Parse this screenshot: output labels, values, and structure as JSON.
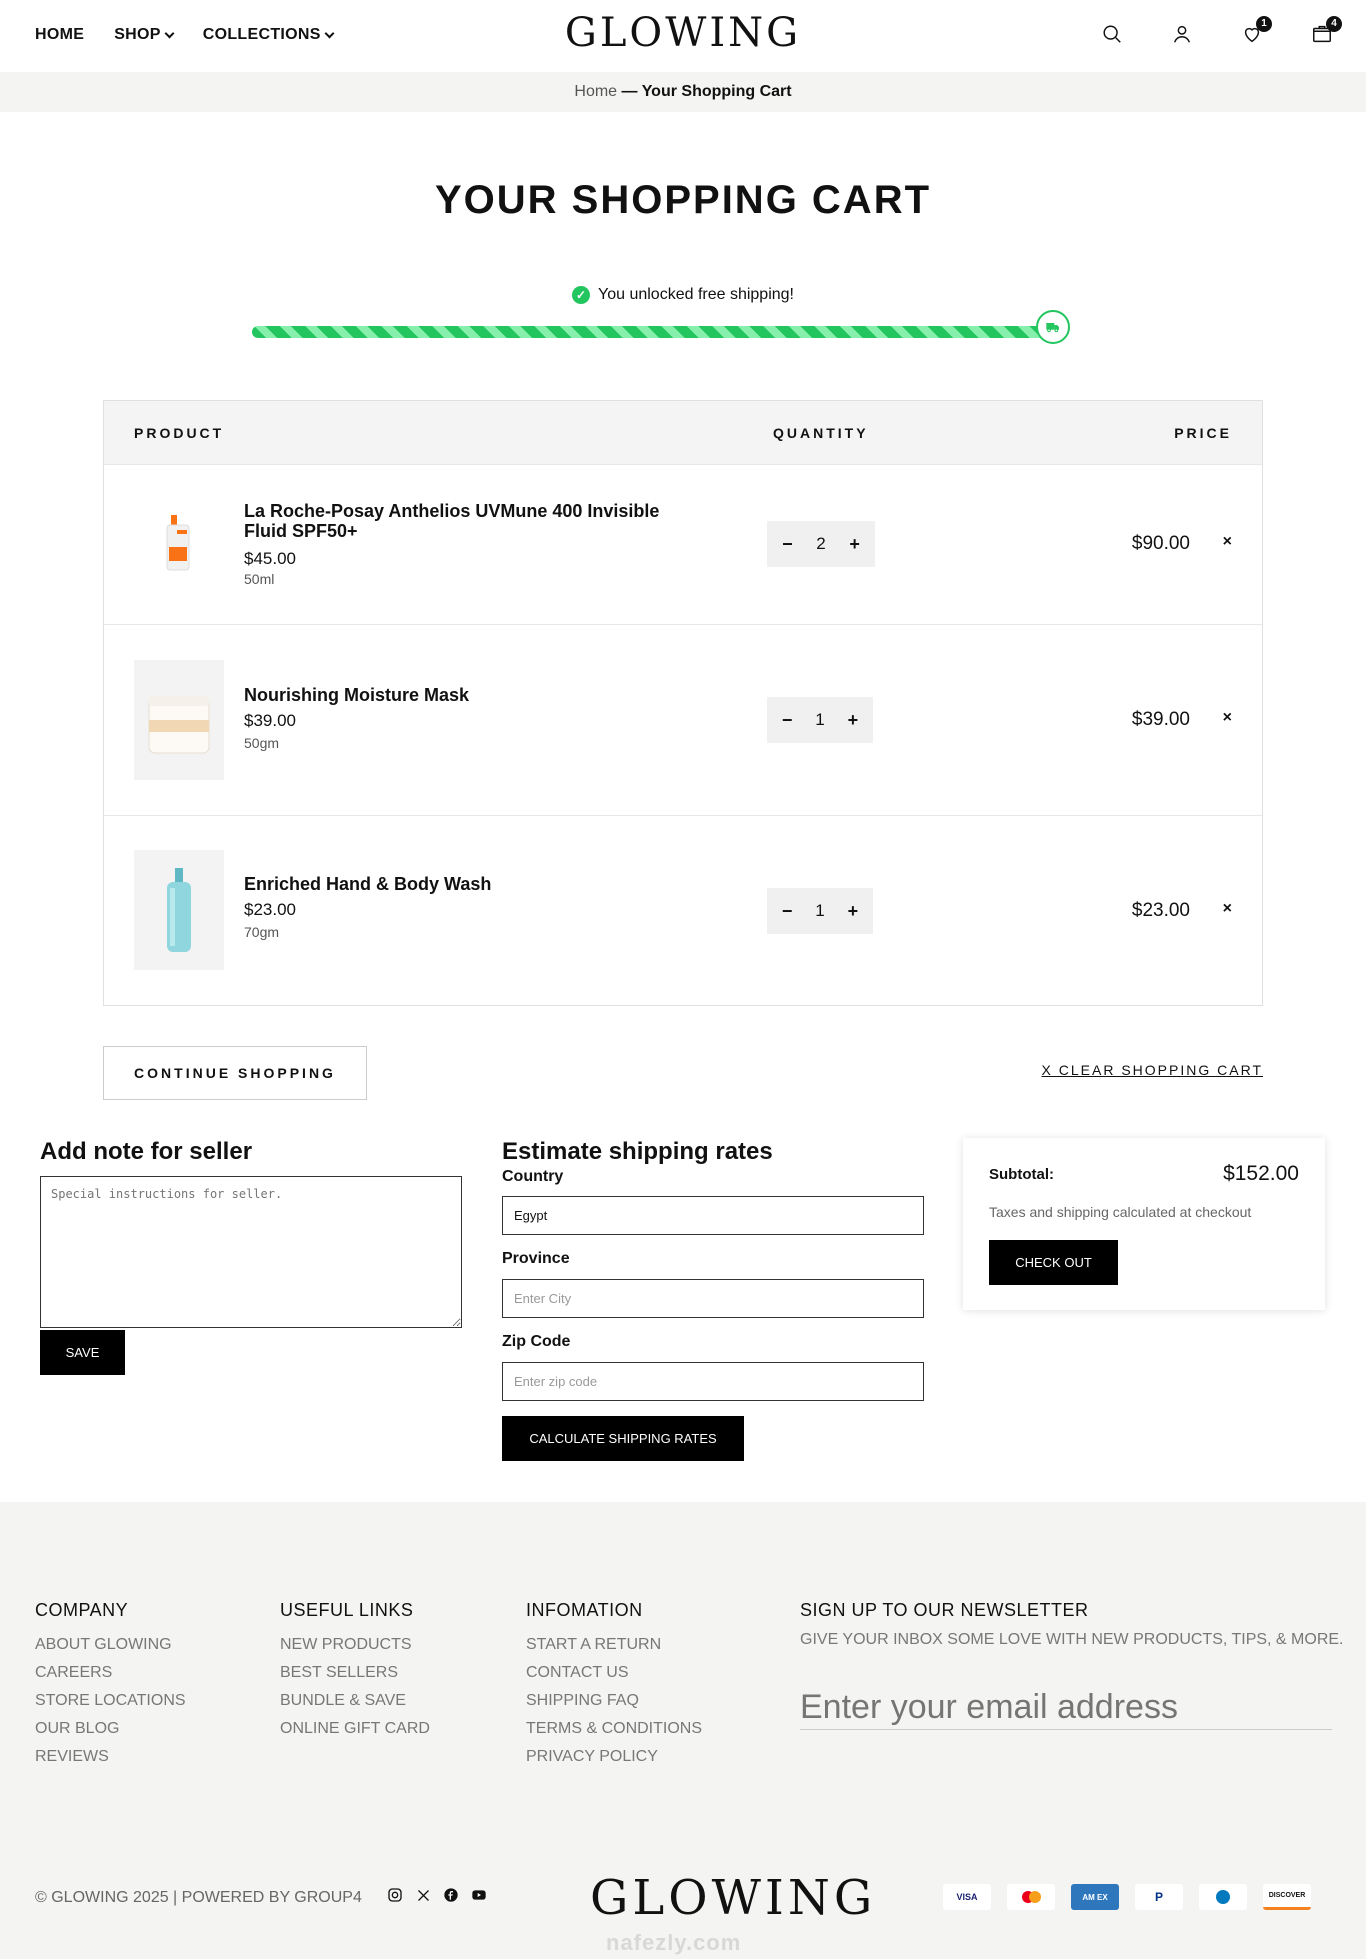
{
  "header": {
    "nav": [
      {
        "label": "HOME",
        "dropdown": false
      },
      {
        "label": "SHOP",
        "dropdown": true
      },
      {
        "label": "COLLECTIONS",
        "dropdown": true
      }
    ],
    "logo": "GLOWING",
    "icons": [
      "search-icon",
      "user-icon",
      "heart-icon",
      "cart-icon"
    ],
    "wishlist_count": "1",
    "cart_count": "4"
  },
  "breadcrumb": {
    "home": "Home",
    "current": "— Your Shopping Cart"
  },
  "page_title": "YOUR SHOPPING CART",
  "shipping": {
    "message": "You unlocked free shipping!",
    "progress_percent": 100,
    "accent": "#22c55e"
  },
  "cart": {
    "headers": {
      "product": "PRODUCT",
      "quantity": "QUANTITY",
      "price": "PRICE"
    },
    "items": [
      {
        "name": "La Roche-Posay Anthelios UVMune 400 Invisible Fluid SPF50+",
        "unit_price": "$45.00",
        "variant": "50ml",
        "quantity": "2",
        "line_price": "$90.00"
      },
      {
        "name": "Nourishing Moisture Mask",
        "unit_price": "$39.00",
        "variant": "50gm",
        "quantity": "1",
        "line_price": "$39.00"
      },
      {
        "name": "Enriched Hand & Body Wash",
        "unit_price": "$23.00",
        "variant": "70gm",
        "quantity": "1",
        "line_price": "$23.00"
      }
    ],
    "minus": "−",
    "plus": "+",
    "remove": "×",
    "continue_label": "CONTINUE SHOPPING",
    "clear_label": "X CLEAR SHOPPING CART"
  },
  "note": {
    "title": "Add note for seller",
    "placeholder": "Special instructions for seller.",
    "save_label": "SAVE"
  },
  "shipping_estimate": {
    "title": "Estimate shipping rates",
    "country_label": "Country",
    "country_value": "Egypt",
    "province_label": "Province",
    "province_placeholder": "Enter City",
    "zip_label": "Zip Code",
    "zip_placeholder": "Enter zip code",
    "button_label": "CALCULATE SHIPPING RATES"
  },
  "summary": {
    "subtotal_label": "Subtotal:",
    "subtotal_value": "$152.00",
    "tax_note": "Taxes and shipping calculated at checkout",
    "checkout_label": "CHECK OUT"
  },
  "footer": {
    "company": {
      "title": "COMPANY",
      "links": [
        "ABOUT GLOWING",
        "CAREERS",
        "STORE LOCATIONS",
        "OUR BLOG",
        "REVIEWS"
      ]
    },
    "useful": {
      "title": "USEFUL LINKS",
      "links": [
        "NEW PRODUCTS",
        "BEST SELLERS",
        "BUNDLE & SAVE",
        "ONLINE GIFT CARD"
      ]
    },
    "info": {
      "title": "INFOMATION",
      "links": [
        "START A RETURN",
        "CONTACT US",
        "SHIPPING FAQ",
        "TERMS & CONDITIONS",
        "PRIVACY POLICY"
      ]
    },
    "newsletter": {
      "title": "SIGN UP TO OUR NEWSLETTER",
      "subtitle": "GIVE YOUR INBOX SOME LOVE WITH NEW PRODUCTS, TIPS, & MORE.",
      "placeholder": "Enter your email address"
    },
    "copyright": "© GLOWING 2025 | POWERED BY GROUP4",
    "socials": [
      "instagram-icon",
      "x-icon",
      "facebook-icon",
      "youtube-icon"
    ],
    "logo": "GLOWING",
    "payments": [
      {
        "name": "visa",
        "label": "VISA"
      },
      {
        "name": "mastercard",
        "label": ""
      },
      {
        "name": "amex",
        "label": "AM EX"
      },
      {
        "name": "paypal",
        "label": "P"
      },
      {
        "name": "diners",
        "label": ""
      },
      {
        "name": "discover",
        "label": "DISCOVER"
      }
    ],
    "watermark": "nafezly.com"
  }
}
